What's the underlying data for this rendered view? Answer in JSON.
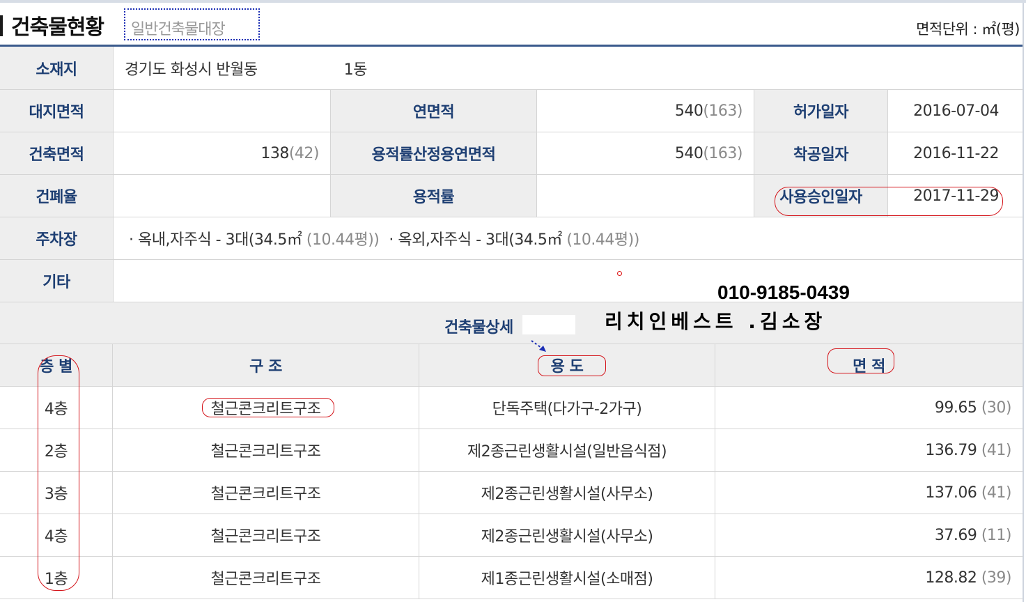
{
  "header": {
    "title": "건축물현황",
    "subtitle": "일반건축물대장",
    "unit": "면적단위 : ㎡(평)"
  },
  "overview": {
    "location_label": "소재지",
    "location_value": "경기도 화성시 반월동",
    "location_dong": "1동",
    "land_area_label": "대지면적",
    "land_area_value": "",
    "total_floor_area_label": "연면적",
    "total_floor_area_value": "540",
    "total_floor_area_pyeong": "(163)",
    "permit_date_label": "허가일자",
    "permit_date_value": "2016-07-04",
    "building_area_label": "건축면적",
    "building_area_value": "138",
    "building_area_pyeong": "(42)",
    "far_floor_area_label": "용적률산정용연면적",
    "far_floor_area_value": "540",
    "far_floor_area_pyeong": "(163)",
    "start_date_label": "착공일자",
    "start_date_value": "2016-11-22",
    "bcr_label": "건폐율",
    "bcr_value": "",
    "far_label": "용적률",
    "far_value": "",
    "approval_date_label": "사용승인일자",
    "approval_date_value": "2017-11-29",
    "parking_label": "주차장",
    "parking_indoor": "· 옥내,자주식 - 3대(34.5㎡",
    "parking_indoor_pyeong": "(10.44평))",
    "parking_outdoor": "· 옥외,자주식 - 3대(34.5㎡",
    "parking_outdoor_pyeong": "(10.44평))",
    "etc_label": "기타",
    "etc_value": ""
  },
  "overlay": {
    "phone": "010-9185-0439",
    "company": "리치인베스트 .김소장"
  },
  "detail": {
    "title": "건축물상세",
    "headers": {
      "floor": "층 별",
      "structure": "구  조",
      "usage": "용  도",
      "area": "면 적"
    },
    "rows": [
      {
        "floor": "4층",
        "structure": "철근콘크리트구조",
        "usage": "단독주택(다가구-2가구)",
        "area": "99.65",
        "pyeong": "(30)"
      },
      {
        "floor": "2층",
        "structure": "철근콘크리트구조",
        "usage": "제2종근린생활시설(일반음식점)",
        "area": "136.79",
        "pyeong": "(41)"
      },
      {
        "floor": "3층",
        "structure": "철근콘크리트구조",
        "usage": "제2종근린생활시설(사무소)",
        "area": "137.06",
        "pyeong": "(41)"
      },
      {
        "floor": "4층",
        "structure": "철근콘크리트구조",
        "usage": "제2종근린생활시설(사무소)",
        "area": "37.69",
        "pyeong": "(11)"
      },
      {
        "floor": "1층",
        "structure": "철근콘크리트구조",
        "usage": "제1종근린생활시설(소매점)",
        "area": "128.82",
        "pyeong": "(39)"
      }
    ]
  },
  "colors": {
    "label_text": "#1e3f73",
    "label_bg": "#eeeeee",
    "header_rule": "#3a5a8c",
    "annotation_red": "#d4141a",
    "annotation_blue": "#1c2fb5"
  }
}
